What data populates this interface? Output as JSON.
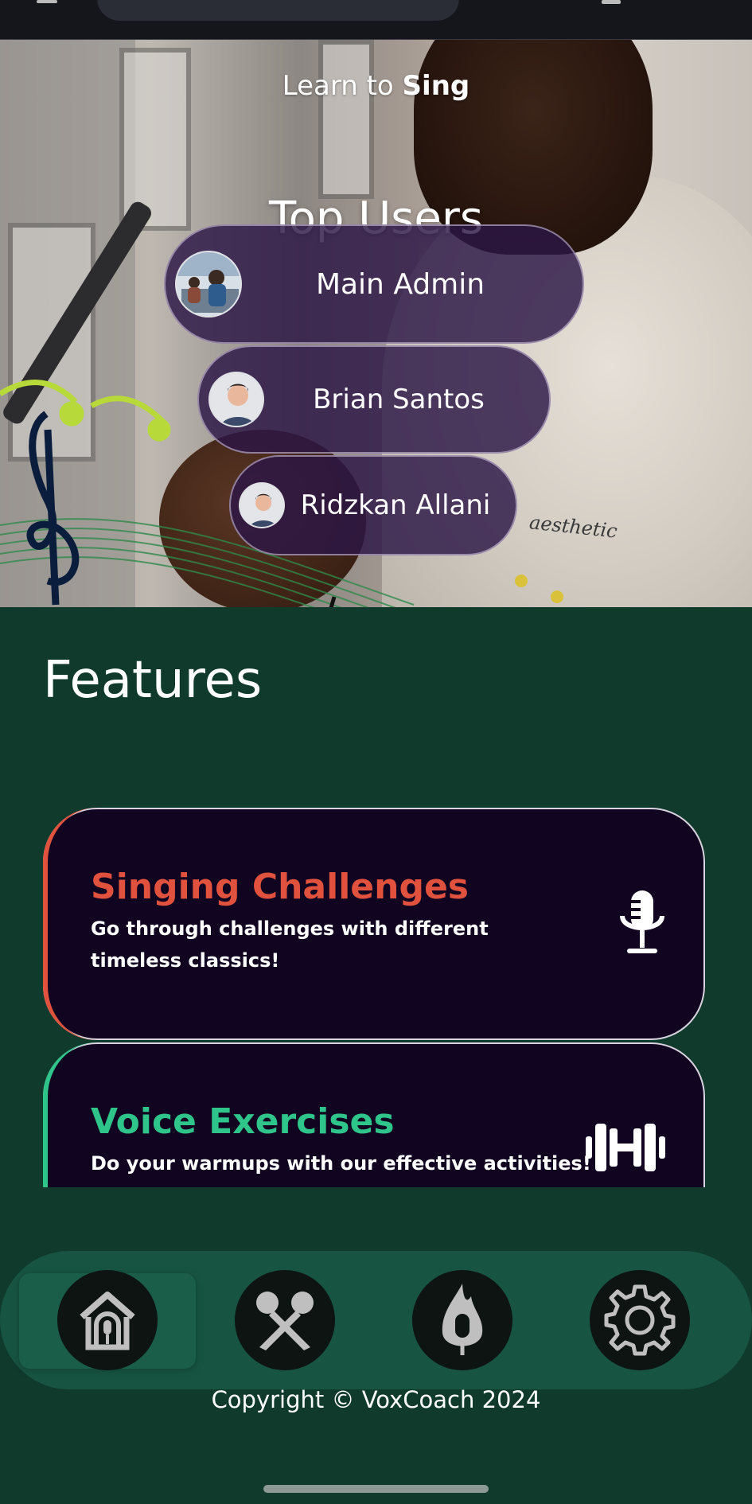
{
  "header": {
    "subtitle_pre": "Learn to ",
    "subtitle_bold": "Sing"
  },
  "top_users": {
    "title": "Top Users",
    "users": [
      {
        "name": "Main Admin"
      },
      {
        "name": "Brian Santos"
      },
      {
        "name": "Ridzkan Allani"
      }
    ]
  },
  "hero": {
    "shirt_text": "aesthetic"
  },
  "features": {
    "title": "Features",
    "cards": [
      {
        "title": "Singing Challenges",
        "description": "Go through challenges with different timeless classics!",
        "icon": "microphone-icon",
        "accent": "#e0523d"
      },
      {
        "title": "Voice Exercises",
        "description": "Do your warmups with our effective activities!",
        "icon": "dumbbell-icon",
        "accent": "#2ec48a"
      }
    ]
  },
  "nav": {
    "items": [
      {
        "icon": "home-icon",
        "active": true
      },
      {
        "icon": "crossed-mics-icon",
        "active": false
      },
      {
        "icon": "flame-mic-icon",
        "active": false
      },
      {
        "icon": "gear-icon",
        "active": false
      }
    ]
  },
  "footer": {
    "copyright": "Copyright © VoxCoach 2024"
  },
  "colors": {
    "background": "#0f3a2c",
    "card": "#100420",
    "nav": "#175542",
    "pill": "#2c1646"
  }
}
